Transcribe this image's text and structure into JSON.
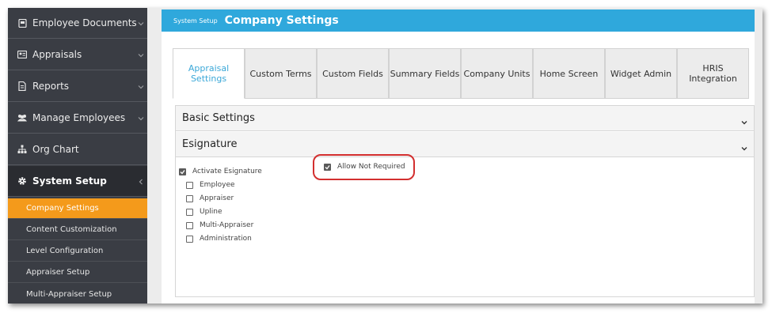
{
  "sidebar": {
    "items": [
      {
        "label": "Employee Documents",
        "icon": "document-icon"
      },
      {
        "label": "Appraisals",
        "icon": "id-card-icon"
      },
      {
        "label": "Reports",
        "icon": "report-icon"
      },
      {
        "label": "Manage Employees",
        "icon": "users-icon"
      },
      {
        "label": "Org Chart",
        "icon": "org-chart-icon"
      },
      {
        "label": "System Setup",
        "icon": "gear-icon"
      }
    ],
    "sub_items": [
      {
        "label": "Company Settings"
      },
      {
        "label": "Content Customization"
      },
      {
        "label": "Level Configuration"
      },
      {
        "label": "Appraiser Setup"
      },
      {
        "label": "Multi-Appraiser Setup"
      }
    ]
  },
  "header": {
    "breadcrumb": "System Setup",
    "title": "Company Settings"
  },
  "tabs": [
    {
      "label": "Appraisal Settings"
    },
    {
      "label": "Custom Terms"
    },
    {
      "label": "Custom Fields"
    },
    {
      "label": "Summary Fields"
    },
    {
      "label": "Company Units"
    },
    {
      "label": "Home Screen"
    },
    {
      "label": "Widget Admin"
    },
    {
      "label": "HRIS Integration"
    }
  ],
  "sections": {
    "basic": {
      "title": "Basic Settings"
    },
    "esignature": {
      "title": "Esignature"
    }
  },
  "esignature": {
    "activate": {
      "label": "Activate Esignature",
      "checked": true
    },
    "options": [
      {
        "label": "Employee",
        "checked": false
      },
      {
        "label": "Appraiser",
        "checked": false
      },
      {
        "label": "Upline",
        "checked": false
      },
      {
        "label": "Multi-Appraiser",
        "checked": false
      },
      {
        "label": "Administration",
        "checked": false
      }
    ],
    "allow_not_required": {
      "label": "Allow Not Required",
      "checked": true
    }
  },
  "colors": {
    "sidebar_bg": "#3a3d44",
    "active_submenu": "#f49a1b",
    "header_bg": "#2fa8dc",
    "active_tab_text": "#3ba8d8",
    "highlight_border": "#d32f2f"
  }
}
